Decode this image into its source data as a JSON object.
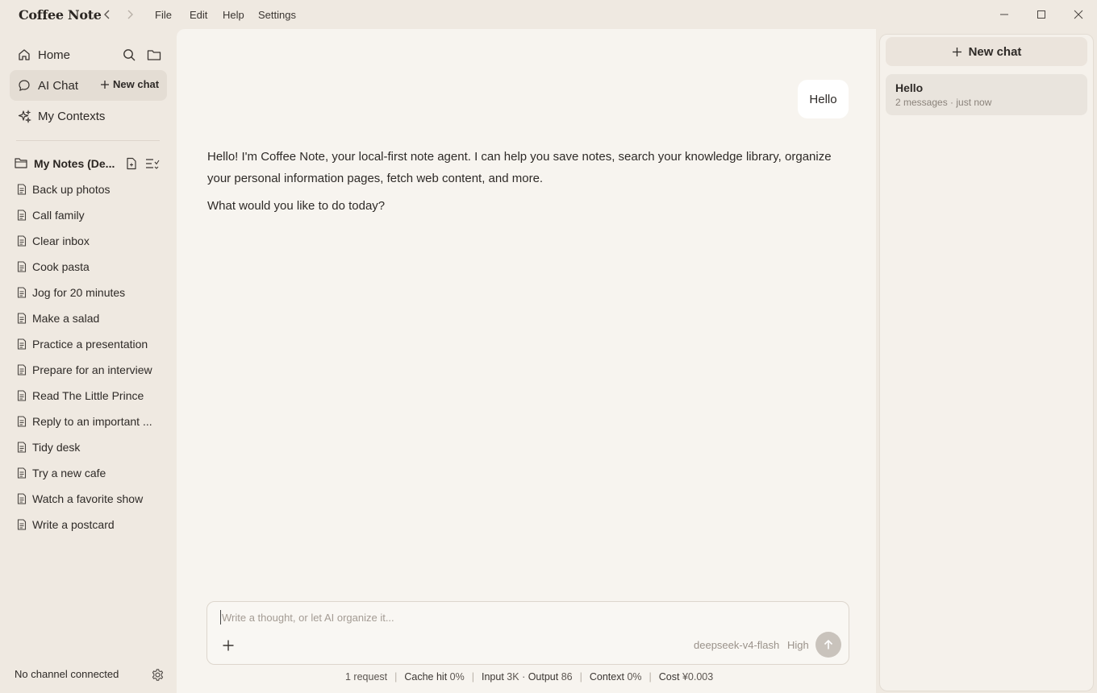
{
  "app": {
    "title": "Coffee Note"
  },
  "menu": [
    "File",
    "Edit",
    "Help",
    "Settings"
  ],
  "sidebar": {
    "home_label": "Home",
    "ai_chat_label": "AI Chat",
    "new_chat_label": "New chat",
    "contexts_label": "My Contexts",
    "folder_label": "My Notes (De...",
    "notes": [
      "Back up photos",
      "Call family",
      "Clear inbox",
      "Cook pasta",
      "Jog for 20 minutes",
      "Make a salad",
      "Practice a presentation",
      "Prepare for an interview",
      "Read The Little Prince",
      "Reply to an important ...",
      "Tidy desk",
      "Try a new cafe",
      "Watch a favorite show",
      "Write a postcard"
    ],
    "channel_status": "No channel connected"
  },
  "conversation": {
    "user_message": "Hello",
    "assistant_paragraphs": [
      "Hello! I'm Coffee Note, your local-first note agent. I can help you save notes, search your knowledge library, organize your personal information pages, fetch web content, and more.",
      "What would you like to do today?"
    ]
  },
  "composer": {
    "placeholder": "Write a thought, or let AI organize it...",
    "model": "deepseek-v4-flash",
    "effort": "High"
  },
  "stats": {
    "requests": "1 request",
    "cache_label": "Cache hit",
    "cache_value": "0%",
    "input_label": "Input",
    "input_value": "3K",
    "output_label": "Output",
    "output_value": "86",
    "context_label": "Context",
    "context_value": "0%",
    "cost_label": "Cost",
    "cost_value": "¥0.003"
  },
  "right_panel": {
    "new_chat_label": "New chat",
    "chats": [
      {
        "title": "Hello",
        "meta": "2 messages · just now"
      }
    ]
  }
}
